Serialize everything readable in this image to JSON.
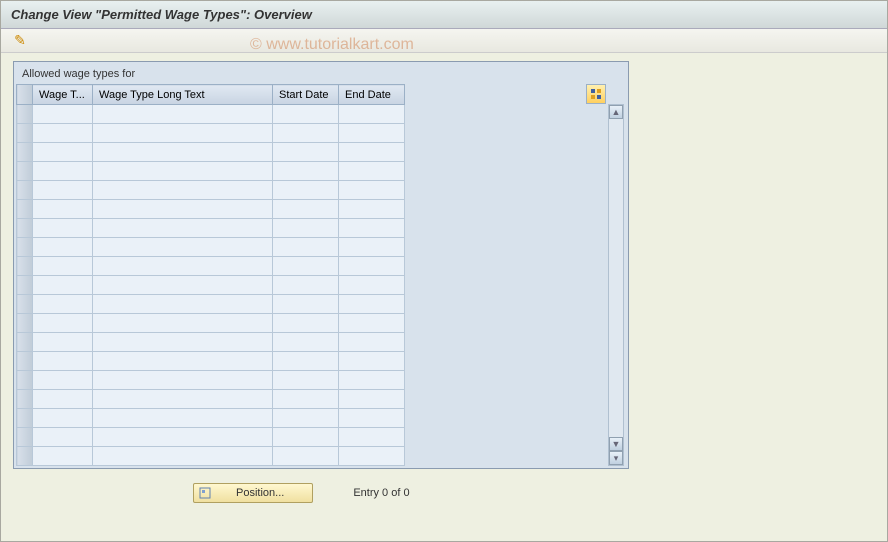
{
  "title": "Change View \"Permitted Wage Types\": Overview",
  "watermark": "© www.tutorialkart.com",
  "panel": {
    "title": "Allowed wage types for",
    "columns": {
      "wage_type": "Wage T...",
      "long_text": "Wage Type Long Text",
      "start_date": "Start Date",
      "end_date": "End Date"
    },
    "rows": [
      {
        "wage_type": "",
        "long_text": "",
        "start_date": "",
        "end_date": ""
      },
      {
        "wage_type": "",
        "long_text": "",
        "start_date": "",
        "end_date": ""
      },
      {
        "wage_type": "",
        "long_text": "",
        "start_date": "",
        "end_date": ""
      },
      {
        "wage_type": "",
        "long_text": "",
        "start_date": "",
        "end_date": ""
      },
      {
        "wage_type": "",
        "long_text": "",
        "start_date": "",
        "end_date": ""
      },
      {
        "wage_type": "",
        "long_text": "",
        "start_date": "",
        "end_date": ""
      },
      {
        "wage_type": "",
        "long_text": "",
        "start_date": "",
        "end_date": ""
      },
      {
        "wage_type": "",
        "long_text": "",
        "start_date": "",
        "end_date": ""
      },
      {
        "wage_type": "",
        "long_text": "",
        "start_date": "",
        "end_date": ""
      },
      {
        "wage_type": "",
        "long_text": "",
        "start_date": "",
        "end_date": ""
      },
      {
        "wage_type": "",
        "long_text": "",
        "start_date": "",
        "end_date": ""
      },
      {
        "wage_type": "",
        "long_text": "",
        "start_date": "",
        "end_date": ""
      },
      {
        "wage_type": "",
        "long_text": "",
        "start_date": "",
        "end_date": ""
      },
      {
        "wage_type": "",
        "long_text": "",
        "start_date": "",
        "end_date": ""
      },
      {
        "wage_type": "",
        "long_text": "",
        "start_date": "",
        "end_date": ""
      },
      {
        "wage_type": "",
        "long_text": "",
        "start_date": "",
        "end_date": ""
      },
      {
        "wage_type": "",
        "long_text": "",
        "start_date": "",
        "end_date": ""
      },
      {
        "wage_type": "",
        "long_text": "",
        "start_date": "",
        "end_date": ""
      },
      {
        "wage_type": "",
        "long_text": "",
        "start_date": "",
        "end_date": ""
      }
    ]
  },
  "footer": {
    "position_label": "Position...",
    "entry_text": "Entry 0 of 0"
  }
}
